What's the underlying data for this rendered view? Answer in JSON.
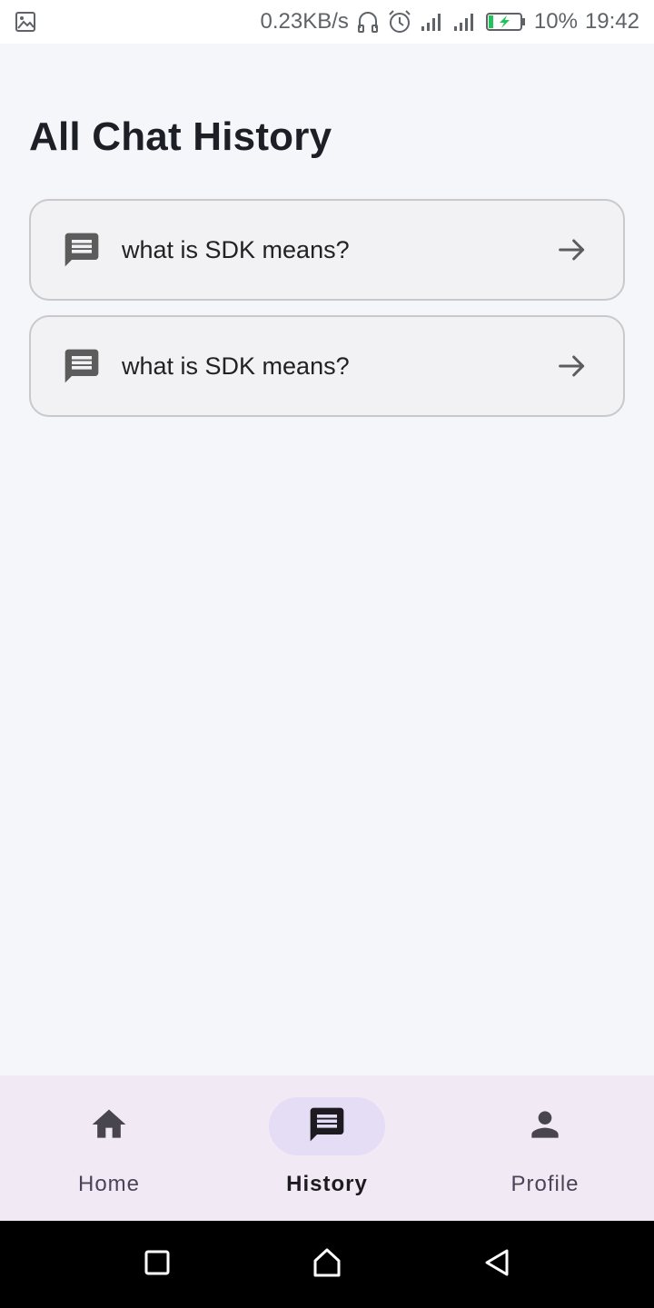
{
  "status_bar": {
    "network_speed": "0.23KB/s",
    "battery": "10%",
    "time": "19:42",
    "icons": [
      "image-icon",
      "headphones-icon",
      "alarm-icon",
      "signal-icon",
      "signal-icon-2",
      "battery-charging-icon"
    ]
  },
  "page": {
    "title": "All Chat History"
  },
  "history": {
    "items": [
      {
        "text": "what is SDK means?",
        "icon": "chat-icon",
        "action_icon": "arrow-right-icon"
      },
      {
        "text": "what is SDK means?",
        "icon": "chat-icon",
        "action_icon": "arrow-right-icon"
      }
    ]
  },
  "bottom_nav": {
    "items": [
      {
        "label": "Home",
        "icon": "home-icon",
        "active": false
      },
      {
        "label": "History",
        "icon": "chat-icon",
        "active": true
      },
      {
        "label": "Profile",
        "icon": "person-icon",
        "active": false
      }
    ]
  },
  "system_nav": {
    "buttons": [
      "recents-button",
      "home-button",
      "back-button"
    ]
  },
  "colors": {
    "background": "#f5f6fa",
    "nav_background": "#f1eaf5",
    "active_pill": "#e5dcf6",
    "card_border": "#c9c9cc",
    "battery_bolt": "#21c45b"
  }
}
